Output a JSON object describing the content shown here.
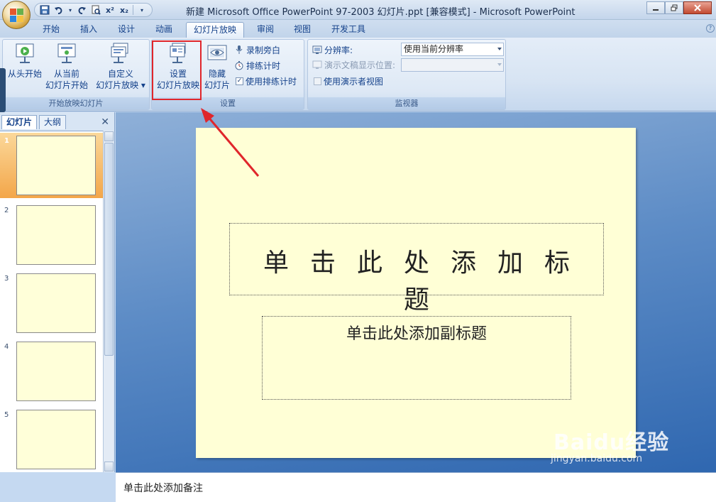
{
  "window": {
    "title": "新建 Microsoft Office PowerPoint 97-2003 幻灯片.ppt [兼容模式] - Microsoft PowerPoint"
  },
  "quick_access": {
    "superscript_label": "x²",
    "subscript_label": "x₂"
  },
  "tabs": [
    "开始",
    "插入",
    "设计",
    "动画",
    "幻灯片放映",
    "审阅",
    "视图",
    "开发工具"
  ],
  "ribbon": {
    "start_group": {
      "label": "开始放映幻灯片",
      "from_beginning": "从头开始",
      "from_current_line1": "从当前",
      "from_current_line2": "幻灯片开始",
      "custom_line1": "自定义",
      "custom_line2": "幻灯片放映 ▾"
    },
    "setup_group": {
      "label": "设置",
      "setup_line1": "设置",
      "setup_line2": "幻灯片放映",
      "hide_line1": "隐藏",
      "hide_line2": "幻灯片",
      "record_narration": "录制旁白",
      "rehearse_timings": "排练计时",
      "use_timings": "使用排练计时"
    },
    "monitors_group": {
      "label": "监视器",
      "resolution_label": "分辨率:",
      "resolution_value": "使用当前分辨率",
      "show_on_label": "演示文稿显示位置:",
      "show_on_value": "",
      "presenter_view": "使用演示者视图"
    }
  },
  "left_pane": {
    "tab_slides": "幻灯片",
    "tab_outline": "大纲",
    "thumbnails": [
      "1",
      "2",
      "3",
      "4",
      "5"
    ]
  },
  "slide": {
    "title_placeholder": "单击此处添加标题",
    "subtitle_placeholder": "单击此处添加副标题"
  },
  "notes": {
    "placeholder": "单击此处添加备注"
  },
  "watermark": {
    "brand": "Baidu经验",
    "url": "jingyan.baidu.com"
  },
  "colors": {
    "highlight_box": "#e0262b",
    "slide_background": "#ffffd6",
    "selected_thumbnail": "#f3a649"
  }
}
